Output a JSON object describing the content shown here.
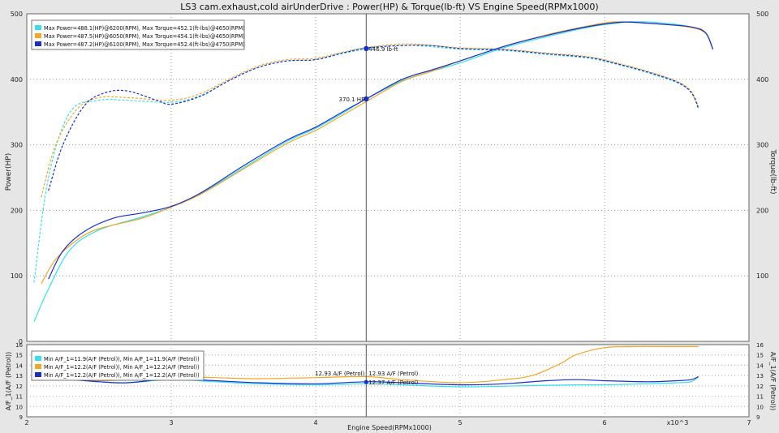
{
  "title": "LS3 cam.exhaust,cold airUnderDrive : Power(HP) & Torque(lb-ft) VS Engine Speed(RPMx1000)",
  "colors": {
    "run1": "#33e0f0",
    "run2": "#f5a623",
    "run3": "#1a2ec9",
    "cursor": "#555555"
  },
  "chart_data": [
    {
      "type": "line",
      "title": "LS3 cam.exhaust,cold airUnderDrive : Power(HP) & Torque(lb-ft) VS Engine Speed(RPMx1000)",
      "xlabel": "Engine Speed(RPMx1000)",
      "ylabel": "Power(HP)",
      "y2label": "Torque(lb-ft)",
      "xlim": [
        2,
        7
      ],
      "ylim": [
        0,
        500
      ],
      "y2lim": [
        0,
        500
      ],
      "x_ticks": [
        "2",
        "3",
        "4",
        "5",
        "6",
        "7"
      ],
      "x_multiplier_label": "x10^3",
      "y_ticks": [
        "0",
        "100",
        "200",
        "300",
        "400",
        "500"
      ],
      "y2_ticks": [
        "100",
        "200",
        "300",
        "400",
        "500"
      ],
      "grid": true,
      "legend_position": "top-left",
      "cursor_x": 4.35,
      "cursor_labels": {
        "torque": "446.9 lb-ft",
        "power": "370.1 HP"
      },
      "series": [
        {
          "name": "Max Power=488.1(HP)@6200(RPM), Max Torque=452.1(ft-lbs)@4650(RPM)",
          "color": "#33e0f0",
          "power": {
            "x": [
              2.05,
              2.15,
              2.3,
              2.5,
              2.8,
              3.0,
              3.2,
              3.5,
              3.8,
              4.0,
              4.2,
              4.35,
              4.6,
              4.8,
              5.0,
              5.3,
              5.6,
              5.9,
              6.1,
              6.2,
              6.4,
              6.6,
              6.7,
              6.75
            ],
            "y": [
              30,
              80,
              140,
              170,
              190,
              205,
              225,
              265,
              305,
              325,
              350,
              370,
              398,
              412,
              425,
              448,
              465,
              480,
              486,
              488,
              486,
              480,
              470,
              445
            ]
          },
          "torque": {
            "x": [
              2.05,
              2.15,
              2.3,
              2.5,
              2.7,
              3.0,
              3.2,
              3.4,
              3.6,
              3.8,
              4.0,
              4.2,
              4.4,
              4.65,
              5.0,
              5.3,
              5.6,
              5.9,
              6.1,
              6.3,
              6.5,
              6.6,
              6.65
            ],
            "y": [
              90,
              250,
              350,
              368,
              368,
              365,
              375,
              398,
              418,
              428,
              430,
              440,
              448,
              452,
              446,
              444,
              438,
              432,
              422,
              410,
              395,
              380,
              355
            ]
          }
        },
        {
          "name": "Max Power=487.5(HP)@6050(RPM), Max Torque=454.1(ft-lbs)@4650(RPM)",
          "color": "#f5a623",
          "power": {
            "x": [
              2.1,
              2.2,
              2.35,
              2.5,
              2.8,
              3.0,
              3.2,
              3.5,
              3.8,
              4.0,
              4.2,
              4.35,
              4.6,
              4.8,
              5.0,
              5.3,
              5.6,
              5.9,
              6.05,
              6.2,
              6.4,
              6.6,
              6.7,
              6.75
            ],
            "y": [
              88,
              125,
              155,
              172,
              188,
              205,
              224,
              263,
              302,
              322,
              347,
              366,
              397,
              412,
              428,
              450,
              468,
              482,
              487.5,
              487,
              484,
              479,
              470,
              446
            ]
          },
          "torque": {
            "x": [
              2.1,
              2.2,
              2.35,
              2.5,
              2.7,
              3.0,
              3.2,
              3.4,
              3.6,
              3.8,
              4.0,
              4.2,
              4.4,
              4.65,
              5.0,
              5.3,
              5.6,
              5.9,
              6.1,
              6.3,
              6.5,
              6.6,
              6.65
            ],
            "y": [
              220,
              300,
              355,
              372,
              372,
              368,
              378,
              400,
              420,
              430,
              432,
              442,
              450,
              454,
              448,
              446,
              440,
              434,
              424,
              412,
              397,
              382,
              358
            ]
          }
        },
        {
          "name": "Max Power=487.2(HP)@6100(RPM), Max Torque=452.4(ft-lbs)@4750(RPM)",
          "color": "#1a2ec9",
          "power": {
            "x": [
              2.15,
              2.25,
              2.4,
              2.6,
              2.8,
              3.0,
              3.2,
              3.5,
              3.8,
              4.0,
              4.2,
              4.35,
              4.6,
              4.8,
              5.0,
              5.3,
              5.6,
              5.9,
              6.1,
              6.2,
              6.4,
              6.6,
              6.7,
              6.75
            ],
            "y": [
              95,
              138,
              168,
              188,
              196,
              206,
              226,
              268,
              307,
              327,
              352,
              370,
              400,
              414,
              428,
              450,
              467,
              481,
              487,
              487,
              484,
              480,
              471,
              446
            ]
          },
          "torque": {
            "x": [
              2.15,
              2.25,
              2.4,
              2.55,
              2.7,
              2.9,
              3.0,
              3.2,
              3.4,
              3.6,
              3.8,
              4.0,
              4.2,
              4.4,
              4.75,
              5.0,
              5.3,
              5.6,
              5.9,
              6.1,
              6.3,
              6.5,
              6.6,
              6.65
            ],
            "y": [
              230,
              300,
              360,
              380,
              382,
              368,
              362,
              374,
              398,
              418,
              428,
              430,
              441,
              449,
              452,
              447,
              445,
              439,
              433,
              423,
              411,
              396,
              380,
              356
            ]
          }
        }
      ]
    },
    {
      "type": "line",
      "xlabel": "Engine Speed(RPMx1000)",
      "ylabel": "A/F_1(A/F (Petrol))",
      "y2label": "A/F_1(A/F (Petrol))",
      "xlim": [
        2,
        7
      ],
      "ylim": [
        9,
        16
      ],
      "y_ticks": [
        "9",
        "10",
        "11",
        "12",
        "13",
        "14",
        "15",
        "16"
      ],
      "y2_ticks": [
        "9",
        "10",
        "11",
        "12",
        "13",
        "14",
        "15",
        "16"
      ],
      "grid": true,
      "legend_position": "top-left",
      "cursor_labels": [
        "12.93 A/F (Petrol)",
        "12.93 A/F (Petrol)",
        "12.37 A/F (Petrol)"
      ],
      "series": [
        {
          "name": "Min A/F_1=11.9(A/F (Petrol)), Min A/F_1=11.9(A/F (Petrol))",
          "color": "#33e0f0",
          "x": [
            2.1,
            2.3,
            2.5,
            2.7,
            3.0,
            3.3,
            3.6,
            4.0,
            4.35,
            4.6,
            5.0,
            5.4,
            5.8,
            6.0,
            6.3,
            6.5,
            6.6,
            6.65
          ],
          "y": [
            12.8,
            12.7,
            12.4,
            12.3,
            12.6,
            12.4,
            12.2,
            12.1,
            12.2,
            12.1,
            11.9,
            12.0,
            12.1,
            12.1,
            12.2,
            12.3,
            12.4,
            12.9
          ]
        },
        {
          "name": "Min A/F_1=12.2(A/F (Petrol)), Min A/F_1=12.2(A/F (Petrol))",
          "color": "#f5a623",
          "x": [
            2.1,
            2.3,
            2.5,
            2.7,
            3.0,
            3.3,
            3.6,
            4.0,
            4.35,
            4.6,
            5.0,
            5.3,
            5.5,
            5.7,
            5.8,
            6.0,
            6.2,
            6.4,
            6.6,
            6.65
          ],
          "y": [
            12.6,
            12.6,
            12.5,
            12.6,
            12.9,
            12.8,
            12.7,
            12.8,
            12.9,
            12.6,
            12.3,
            12.6,
            13.0,
            14.2,
            15.0,
            15.7,
            15.8,
            15.8,
            15.8,
            15.8
          ]
        },
        {
          "name": "Min A/F_1=12.2(A/F (Petrol)), Min A/F_1=12.2(A/F (Petrol))",
          "color": "#1a2ec9",
          "x": [
            2.1,
            2.3,
            2.5,
            2.7,
            3.0,
            3.3,
            3.6,
            4.0,
            4.35,
            4.6,
            5.0,
            5.3,
            5.6,
            5.8,
            6.0,
            6.3,
            6.5,
            6.6,
            6.65
          ],
          "y": [
            12.7,
            12.6,
            12.4,
            12.3,
            12.7,
            12.5,
            12.3,
            12.2,
            12.4,
            12.3,
            12.1,
            12.2,
            12.5,
            12.6,
            12.5,
            12.4,
            12.5,
            12.6,
            12.9
          ]
        }
      ]
    }
  ]
}
